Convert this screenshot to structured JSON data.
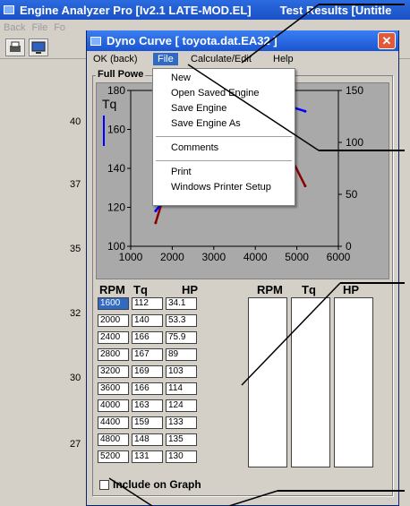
{
  "bg_window": {
    "title": "Engine Analyzer Pro [Iv2.1 LATE-MOD.EL]",
    "title_right": "Test Results [Untitle",
    "menu": [
      "Back",
      "File",
      "Fo"
    ],
    "axis_ticks": [
      "40",
      "37",
      "35",
      "32",
      "30",
      "27"
    ]
  },
  "dialog": {
    "title": "Dyno Curve  [ toyota.dat.EA32 ]",
    "close_glyph": "✕",
    "menu": {
      "ok_back": "OK (back)",
      "file": "File",
      "calculate": "Calculate/Edit",
      "help": "Help"
    },
    "group_title": "Full Powe",
    "include_label": "Include on Graph"
  },
  "file_menu": {
    "items": [
      "New",
      "Open Saved Engine",
      "Save Engine",
      "Save Engine As",
      "Comments",
      "Print",
      "Windows Printer Setup"
    ]
  },
  "chart_data": {
    "type": "line",
    "xlabel": "",
    "ylabel": "Tq",
    "x_ticks": [
      "1000",
      "2000",
      "3000",
      "4000",
      "5000",
      "6000"
    ],
    "y_left_ticks": [
      "100",
      "120",
      "140",
      "160",
      "180"
    ],
    "y_right_ticks": [
      "0",
      "50",
      "100",
      "150"
    ],
    "xlim": [
      1000,
      6000
    ],
    "ylim_left": [
      100,
      180
    ],
    "ylim_right": [
      0,
      150
    ],
    "grid": false,
    "series": [
      {
        "name": "Tq",
        "axis": "left",
        "color": "#8b0000",
        "x": [
          1600,
          2000,
          2400,
          2800,
          3200,
          3600,
          4000,
          4400,
          4800,
          5200
        ],
        "values": [
          112,
          140,
          166,
          167,
          169,
          166,
          163,
          159,
          148,
          131
        ]
      },
      {
        "name": "HP",
        "axis": "right",
        "color": "#0000ff",
        "x": [
          1600,
          2000,
          2400,
          2800,
          3200,
          3600,
          4000,
          4400,
          4800,
          5200
        ],
        "values": [
          34.1,
          53.3,
          75.9,
          89,
          103,
          114,
          124,
          133,
          135,
          130
        ]
      }
    ]
  },
  "table": {
    "headers": [
      "RPM",
      "Tq",
      "HP",
      "RPM",
      "Tq",
      "HP"
    ],
    "rows": [
      [
        "1600",
        "112",
        "34.1"
      ],
      [
        "2000",
        "140",
        "53.3"
      ],
      [
        "2400",
        "166",
        "75.9"
      ],
      [
        "2800",
        "167",
        "89"
      ],
      [
        "3200",
        "169",
        "103"
      ],
      [
        "3600",
        "166",
        "114"
      ],
      [
        "4000",
        "163",
        "124"
      ],
      [
        "4400",
        "159",
        "133"
      ],
      [
        "4800",
        "148",
        "135"
      ],
      [
        "5200",
        "131",
        "130"
      ]
    ]
  },
  "colors": {
    "title_bar": "#1a55d0",
    "menu_highlight": "#316ac5",
    "torque_line": "#8b0000",
    "hp_line": "#0000ff"
  }
}
